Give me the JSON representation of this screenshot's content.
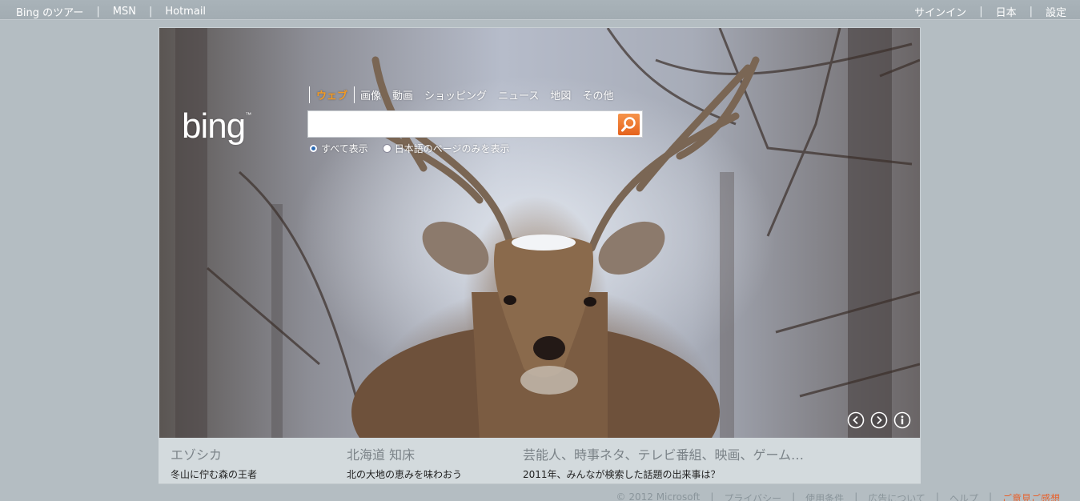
{
  "topbar": {
    "left_links": [
      "Bing のツアー",
      "MSN",
      "Hotmail"
    ],
    "right_links": [
      "サインイン",
      "日本",
      "設定"
    ],
    "separator": "|"
  },
  "logo": {
    "text": "bing",
    "tm": "™"
  },
  "nav": {
    "tabs": [
      "ウェブ",
      "画像",
      "動画",
      "ショッピング",
      "ニュース",
      "地図",
      "その他"
    ],
    "active": "ウェブ"
  },
  "search": {
    "value": "",
    "placeholder": ""
  },
  "radios": [
    {
      "label": "すべて表示",
      "checked": true
    },
    {
      "label": "日本語のページのみを表示",
      "checked": false
    }
  ],
  "captions": [
    {
      "title": "エゾシカ",
      "subtitle": "冬山に佇む森の王者"
    },
    {
      "title": "北海道 知床",
      "subtitle": "北の大地の恵みを味わおう"
    },
    {
      "title": "芸能人、時事ネタ、テレビ番組、映画、ゲーム…",
      "subtitle": "2011年、みんなが検索した話題の出来事は？"
    }
  ],
  "footer": {
    "items": [
      "© 2012 Microsoft",
      "プライバシー",
      "使用条件",
      "広告について",
      "ヘルプ"
    ],
    "feedback": "ご意見ご感想"
  },
  "colors": {
    "accent": "#f29a24",
    "search_button": "#e5621c",
    "feedback": "#e8612c"
  },
  "icons": [
    "search-icon",
    "prev-image-icon",
    "next-image-icon",
    "info-icon"
  ]
}
